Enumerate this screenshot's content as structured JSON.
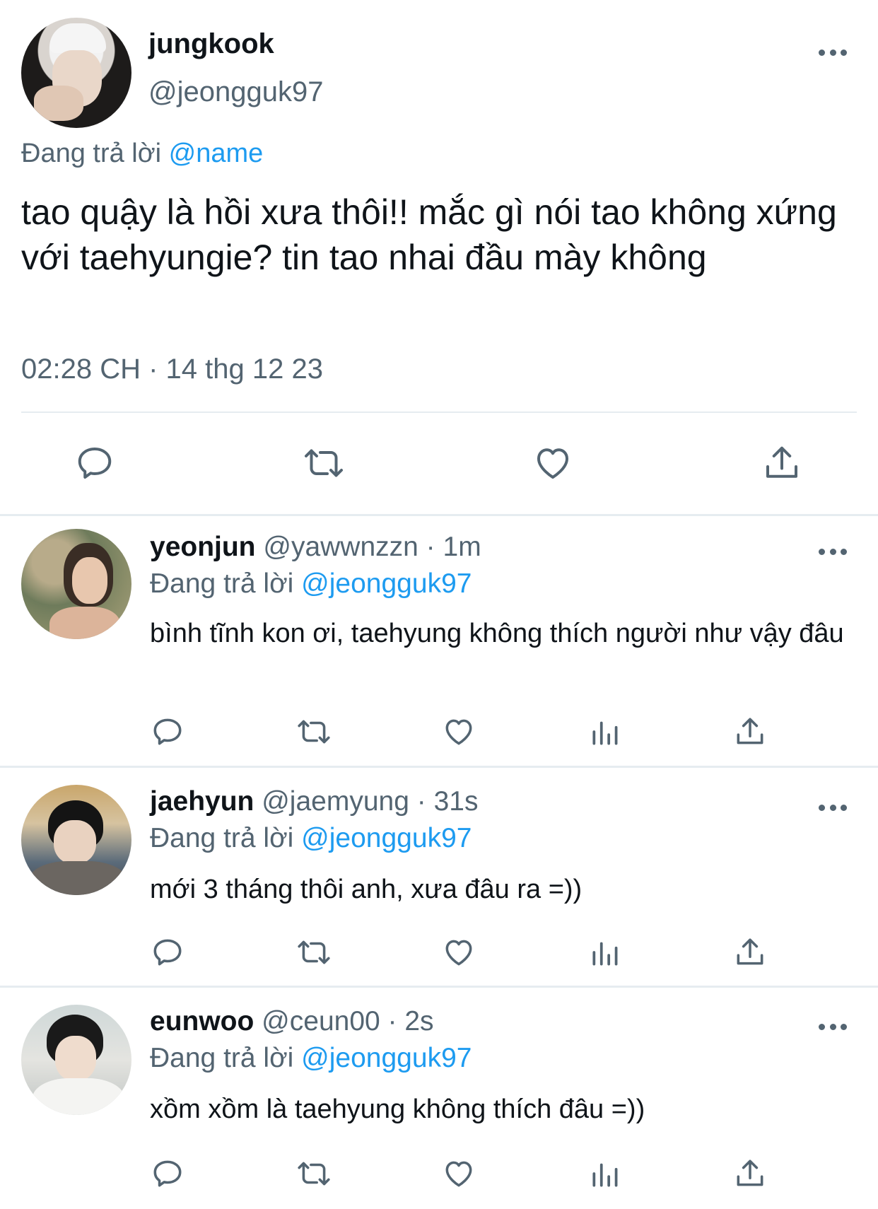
{
  "main_tweet": {
    "author_name": "jungkook",
    "author_handle": "@jeongguk97",
    "replying_prefix": "Đang trả lời",
    "replying_to": "@name",
    "text": "tao quậy là hồi xưa thôi!! mắc gì nói tao không xứng với taehyungie? tin tao nhai đầu mày không",
    "timestamp": "02:28 CH · 14 thg 12 23",
    "actions": [
      "reply-icon",
      "retweet-icon",
      "like-icon",
      "share-icon"
    ]
  },
  "replies": [
    {
      "name": "yeonjun",
      "handle_time": "@yawwnzzn · 1m",
      "replying_prefix": "Đang trả lời",
      "replying_to": "@jeongguk97",
      "text": "bình tĩnh kon ơi, taehyung không thích người như vậy đâu"
    },
    {
      "name": "jaehyun",
      "handle_time": "@jaemyung · 31s",
      "replying_prefix": "Đang trả lời",
      "replying_to": "@jeongguk97",
      "text": "mới 3 tháng thôi anh, xưa đâu ra =))"
    },
    {
      "name": "eunwoo",
      "handle_time": "@ceun00 · 2s",
      "replying_prefix": "Đang trả lời",
      "replying_to": "@jeongguk97",
      "text": "xồm xồm là taehyung không thích đâu =))"
    }
  ],
  "reply_actions": [
    "reply-icon",
    "retweet-icon",
    "like-icon",
    "views-icon",
    "share-icon"
  ],
  "colors": {
    "text": "#0f1419",
    "secondary": "#536471",
    "link": "#1d9bf0",
    "divider": "#e6ecf0"
  }
}
